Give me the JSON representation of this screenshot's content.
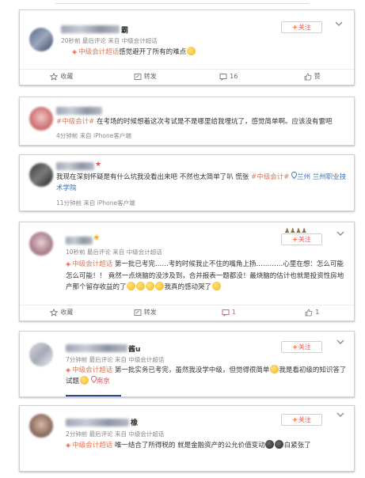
{
  "posts": [
    {
      "name_tail": "霸",
      "meta": "20秒前 最后评论 来自 中级会计超话",
      "follow_plus": "+",
      "follow_label": "关注",
      "content_tag": "中级会计超话",
      "content_text": "感觉避开了所有的难点",
      "actions": {
        "fav": "收藏",
        "repost": "转发",
        "comment": "16",
        "like": "赞"
      }
    },
    {
      "content_tag": "#中级会计#",
      "content_text": " 在考场的时候想着这次考试是不是哪里给我埋坑了，感觉简单啊。应该没有雷吧",
      "meta": "4分钟前 来自 iPhone客户端"
    },
    {
      "content_text_a": "我现在深刻怀疑是有什么坑我没看出来吧 不然也太简单了叭 慌张 ",
      "content_tag": "#中级会计#",
      "location": "兰州 兰州职业技术学院",
      "meta": "11分钟前 来自 iPhone客户端"
    },
    {
      "meta": "10秒前 最后评论 来自 中级会计超话",
      "follow_plus": "+",
      "follow_label": "关注",
      "content_tag": "中级会计超话",
      "content_text": " 第一批已考完……考的时候我止不住的嘴角上扬…………心里在想：怎么可能怎么可能！！ 竟然一点烧脑的没涉及到，合并报表一题都没！最烧脑的估计也就是投资性房地产那个留存收益的了",
      "content_text_end": "我真的感动哭了",
      "actions": {
        "fav": "收藏",
        "repost": "转发",
        "comment": "1",
        "like": "1"
      }
    },
    {
      "name_tail": "酱u",
      "meta": "7分钟前 最后评论 来自 中级会计超话",
      "follow_plus": "+",
      "follow_label": "关注",
      "content_tag": "中级会计超话",
      "content_text": " 第一批实务已考完，虽然我没学中级，但觉得很简单",
      "content_text_b": "我是看初级的知识答了试题",
      "location": "南京"
    },
    {
      "name_tail": "橡",
      "meta": "2分钟前 最后评论 来自 中级会计超话",
      "follow_plus": "+",
      "follow_label": "关注",
      "content_tag": "中级会计超话",
      "content_text": " 唯一结合了所得税的 就是金融资产的公允价值变动",
      "content_text_end": "白紧张了"
    }
  ]
}
